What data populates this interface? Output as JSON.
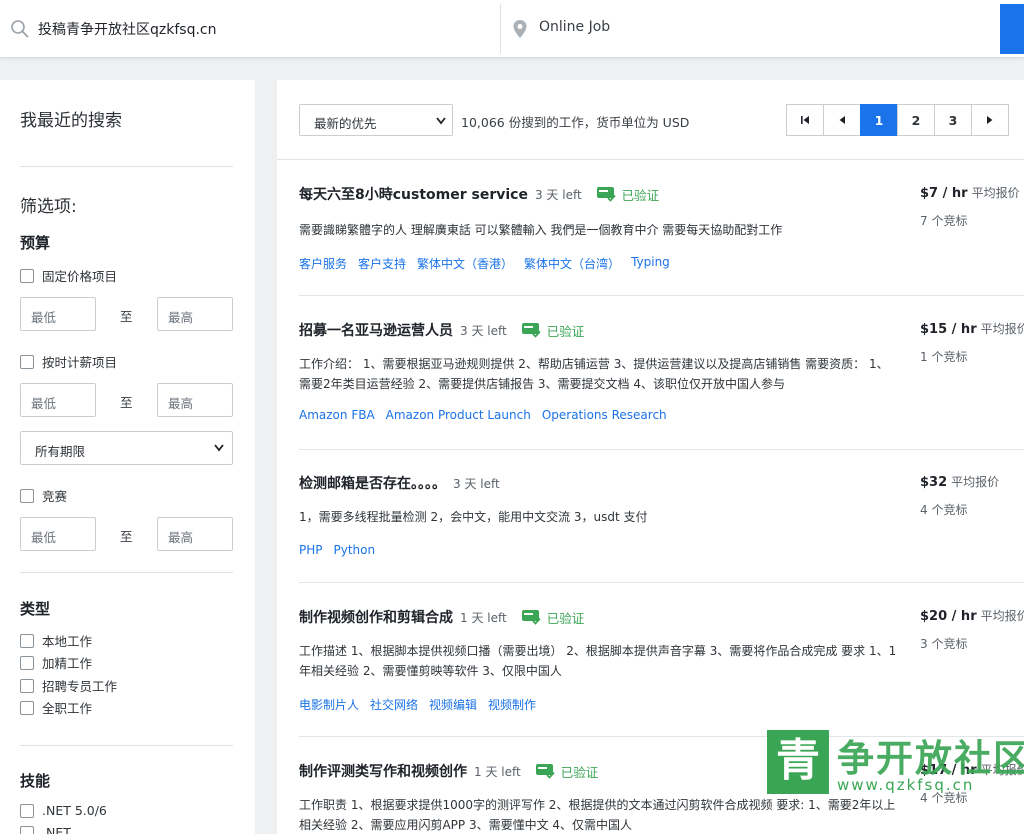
{
  "search": {
    "value": "投稿青争开放社区qzkfsq.cn",
    "location": "Online Job"
  },
  "sidebar": {
    "recent_title": "我最近的搜索",
    "filter_title": "筛选项:",
    "budget": {
      "heading": "预算",
      "fixed_label": "固定价格项目",
      "hourly_label": "按时计薪项目",
      "min": "最低",
      "to": "至",
      "max": "最高",
      "duration_select": "所有期限",
      "contest_label": "竞赛"
    },
    "type": {
      "heading": "类型",
      "items": [
        "本地工作",
        "加精工作",
        "招聘专员工作",
        "全职工作"
      ]
    },
    "skills": {
      "heading": "技能",
      "items": [
        ".NET 5.0/6",
        ".NET"
      ]
    }
  },
  "toolbar": {
    "sort_value": "最新的优先",
    "count_text": "10,066 份搜到的工作，货币单位为 USD",
    "pages": [
      "1",
      "2",
      "3"
    ],
    "first_icon": "first-page-icon",
    "prev_icon": "prev-page-icon",
    "next_icon": "next-page-icon"
  },
  "jobs": [
    {
      "title": "每天六至8小時customer service",
      "time_left": "3 天 left",
      "verified": "已验证",
      "desc": "需要識睇繁體字的人 理解廣東話 可以繁體輸入 我們是一個教育中介 需要每天協助配對工作",
      "tags": [
        "客户服务",
        "客户支持",
        "繁体中文（香港）",
        "繁体中文（台湾）",
        "Typing"
      ],
      "price": "$7 / hr",
      "price_label": "平均报价",
      "bids": "7 个竞标"
    },
    {
      "title": "招募一名亚马逊运营人员",
      "time_left": "3 天 left",
      "verified": "已验证",
      "desc": "工作介绍： 1、需要根据亚马逊规则提供 2、帮助店铺运营 3、提供运营建议以及提高店铺销售 需要资质： 1、需要2年类目运营经验 2、需要提供店铺报告 3、需要提交文档 4、该职位仅开放中国人参与",
      "tags": [
        "Amazon FBA",
        "Amazon Product Launch",
        "Operations Research"
      ],
      "price": "$15 / hr",
      "price_label": "平均报价",
      "bids": "1 个竞标"
    },
    {
      "title": "检测邮箱是否存在。。。。",
      "time_left": "3 天 left",
      "verified": "",
      "desc": "1，需要多线程批量检测 2，会中文，能用中文交流 3，usdt 支付",
      "tags": [
        "PHP",
        "Python"
      ],
      "price": "$32",
      "price_label": "平均报价",
      "bids": "4 个竞标"
    },
    {
      "title": "制作视频创作和剪辑合成",
      "time_left": "1 天 left",
      "verified": "已验证",
      "desc": "工作描述 1、根据脚本提供视频口播（需要出境） 2、根据脚本提供声音字幕 3、需要将作品合成完成 要求 1、1年相关经验 2、需要懂剪映等软件 3、仅限中国人",
      "tags": [
        "电影制片人",
        "社交网络",
        "视频编辑",
        "视频制作"
      ],
      "price": "$20 / hr",
      "price_label": "平均报价",
      "bids": "3 个竞标"
    },
    {
      "title": "制作评测类写作和视频创作",
      "time_left": "1 天 left",
      "verified": "已验证",
      "desc": "工作职责 1、根据要求提供1000字的测评写作 2、根据提供的文本通过闪剪软件合成视频 要求: 1、需要2年以上相关经验 2、需要应用闪剪APP 3、需要懂中文 4、仅需中国人",
      "tags": [],
      "price": "$17 / hr",
      "price_label": "平均报价",
      "bids": "4 个竞标"
    }
  ],
  "watermark": {
    "glyph": "青",
    "text": "争开放社区",
    "url": "www.qzkfsq.cn"
  },
  "colors": {
    "accent": "#1a73e8",
    "verified": "#3aa655"
  }
}
